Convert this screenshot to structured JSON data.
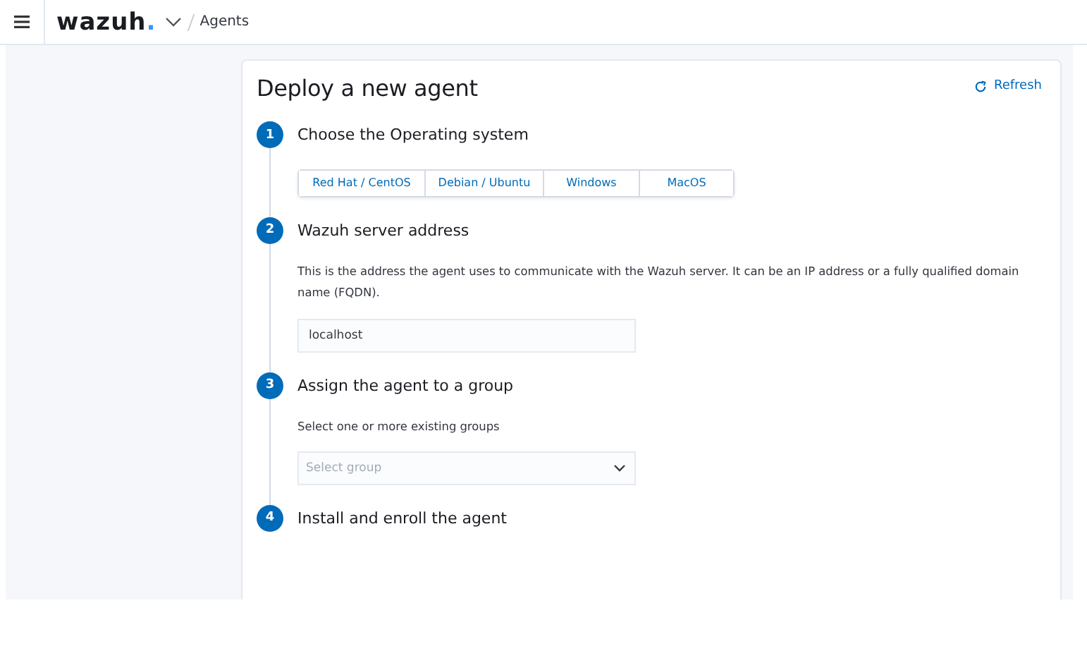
{
  "header": {
    "logo": "wazuh",
    "logo_dot": ".",
    "breadcrumb": "Agents"
  },
  "panel": {
    "title": "Deploy a new agent",
    "refresh": "Refresh",
    "steps": [
      {
        "number": "1",
        "title": "Choose the Operating system",
        "kind": "os-buttons",
        "options": [
          {
            "label": "Red Hat / CentOS",
            "selected": false
          },
          {
            "label": "Debian / Ubuntu",
            "selected": false
          },
          {
            "label": "Windows",
            "selected": false
          },
          {
            "label": "MacOS",
            "selected": false
          }
        ]
      },
      {
        "number": "2",
        "title": "Wazuh server address",
        "kind": "text-field",
        "description": "This is the address the agent uses to communicate with the Wazuh server. It can be an IP address or a fully qualified domain name (FQDN).",
        "value": "localhost"
      },
      {
        "number": "3",
        "title": "Assign the agent to a group",
        "kind": "select",
        "description": "Select one or more existing groups",
        "placeholder": "Select group"
      },
      {
        "number": "4",
        "title": "Install and enroll the agent",
        "kind": "heading"
      }
    ]
  }
}
